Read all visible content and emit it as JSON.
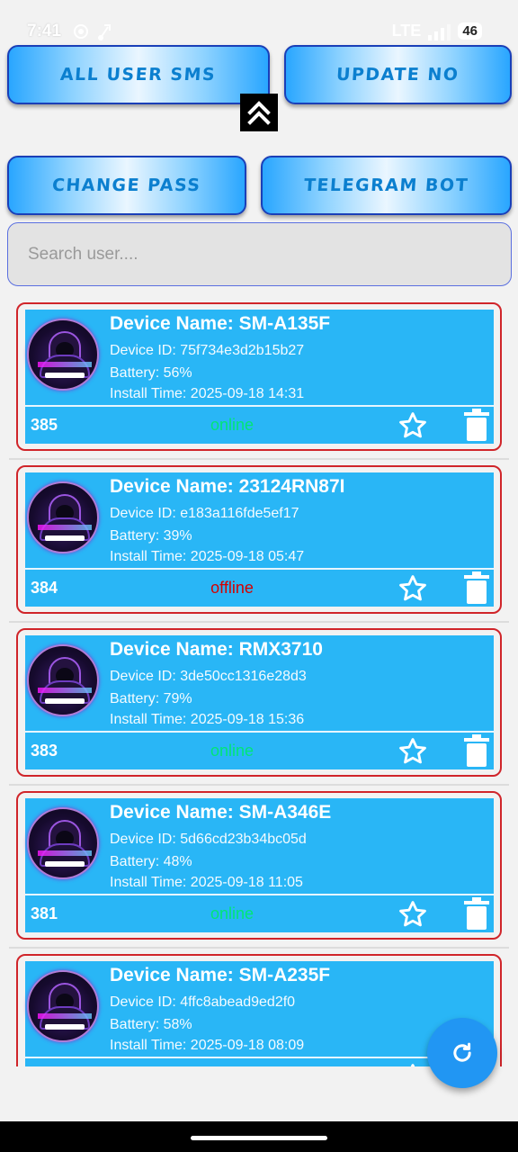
{
  "status_bar": {
    "time": "7:41",
    "network": "LTE",
    "battery": "46"
  },
  "buttons": {
    "all_user_sms": "ALL USER SMS",
    "update_no": "UPDATE NO",
    "change_pass": "CHANGE PASS",
    "telegram_bot": "TELEGRAM BOT"
  },
  "search": {
    "placeholder": "Search user....",
    "value": ""
  },
  "colors": {
    "online": "#00e676",
    "offline": "#d50000",
    "card_bg": "#29b6f6",
    "card_border": "#d0252a",
    "fab": "#2196f3"
  },
  "devices": [
    {
      "name": "Device Name: SM-A135F",
      "id": "Device ID: 75f734e3d2b15b27",
      "battery": "Battery: 56%",
      "install": "Install Time: 2025-09-18 14:31",
      "number": "385",
      "status": "online"
    },
    {
      "name": "Device Name: 23124RN87I",
      "id": "Device ID: e183a116fde5ef17",
      "battery": "Battery: 39%",
      "install": "Install Time: 2025-09-18 05:47",
      "number": "384",
      "status": "offline"
    },
    {
      "name": "Device Name: RMX3710",
      "id": "Device ID: 3de50cc1316e28d3",
      "battery": "Battery: 79%",
      "install": "Install Time: 2025-09-18 15:36",
      "number": "383",
      "status": "online"
    },
    {
      "name": "Device Name: SM-A346E",
      "id": "Device ID: 5d66cd23b34bc05d",
      "battery": "Battery: 48%",
      "install": "Install Time: 2025-09-18 11:05",
      "number": "381",
      "status": "online"
    },
    {
      "name": "Device Name: SM-A235F",
      "id": "Device ID: 4ffc8abead9ed2f0",
      "battery": "Battery: 58%",
      "install": "Install Time: 2025-09-18 08:09",
      "number": "",
      "status": ""
    }
  ],
  "icons": {
    "collapse": "double-chevron-up-icon",
    "favorite": "star-outline-icon",
    "delete": "trash-icon",
    "refresh": "refresh-icon"
  }
}
